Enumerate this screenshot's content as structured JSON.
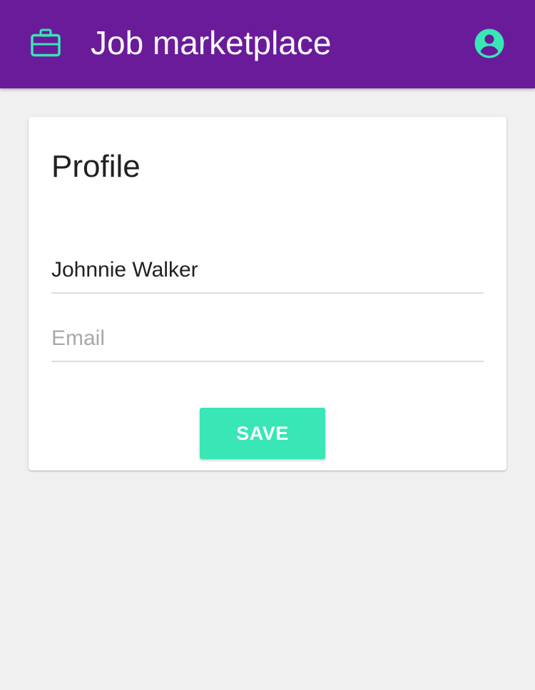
{
  "app_bar": {
    "title": "Job marketplace",
    "brand_icon": "briefcase-icon",
    "account_icon": "account-circle-icon",
    "background_color": "#6a1b9a",
    "accent_color": "#38e6b6"
  },
  "profile_card": {
    "title": "Profile",
    "name_field": {
      "value": "Johnnie Walker",
      "placeholder": ""
    },
    "email_field": {
      "value": "",
      "placeholder": "Email"
    },
    "save_label": "SAVE"
  }
}
